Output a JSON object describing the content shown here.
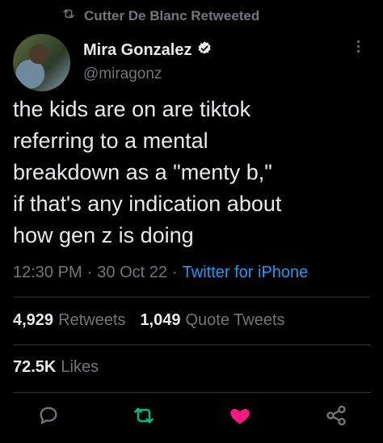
{
  "retweet_context": {
    "label": "Cutter De Blanc Retweeted"
  },
  "author": {
    "display_name": "Mira Gonzalez",
    "handle": "@miragonz"
  },
  "tweet": {
    "text": "the kids are on are tiktok\nreferring to a mental\nbreakdown as a \"menty b,\"\nif that's any indication about\nhow gen z is doing",
    "time": "12:30 PM",
    "date": "30 Oct 22",
    "sep": "·",
    "source": "Twitter for iPhone"
  },
  "stats": {
    "retweets_count": "4,929",
    "retweets_label": "Retweets",
    "quotes_count": "1,049",
    "quotes_label": "Quote Tweets",
    "likes_count": "72.5K",
    "likes_label": "Likes"
  },
  "icons": {
    "retweet_context": "retweet-icon",
    "verified": "verified-badge-icon",
    "reply": "reply-icon",
    "retweet": "retweet-icon",
    "like": "heart-filled-icon",
    "share": "share-icon"
  },
  "colors": {
    "background": "#000000",
    "text": "#e7e9ea",
    "secondary": "#71767b",
    "link": "#1d9bf0",
    "retweet_green": "#00ba7c",
    "like_pink": "#f91880"
  }
}
